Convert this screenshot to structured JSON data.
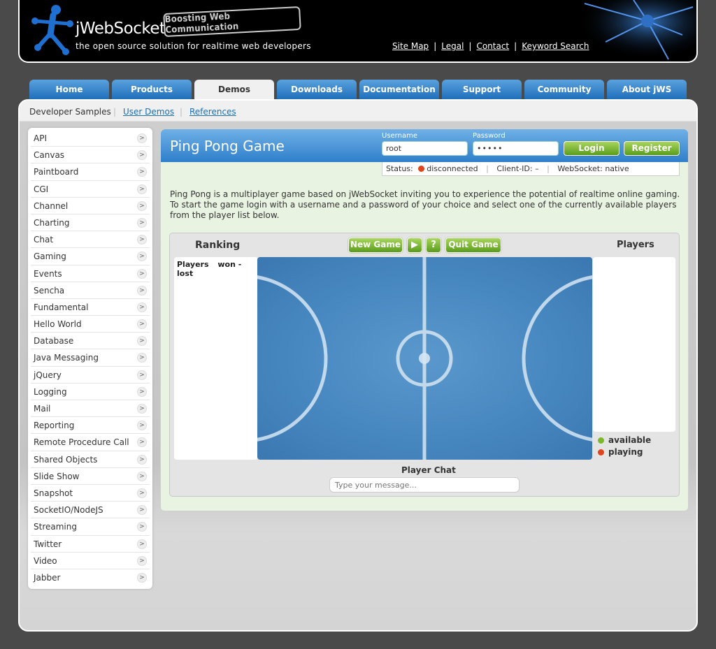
{
  "header": {
    "logo_text": "jWebSocket",
    "slogan": "Boosting Web Communication",
    "tagline": "the open source solution for realtime web developers",
    "links": [
      "Site Map",
      "Legal",
      "Contact",
      "Keyword Search"
    ]
  },
  "tabs": [
    {
      "label": "Home"
    },
    {
      "label": "Products"
    },
    {
      "label": "Demos"
    },
    {
      "label": "Downloads"
    },
    {
      "label": "Documentation"
    },
    {
      "label": "Support"
    },
    {
      "label": "Community"
    },
    {
      "label": "About jWS"
    }
  ],
  "subnav": {
    "current": "Developer Samples",
    "links": [
      "User Demos",
      "References"
    ]
  },
  "sidebar": {
    "items": [
      "API",
      "Canvas",
      "Paintboard",
      "CGI",
      "Channel",
      "Charting",
      "Chat",
      "Gaming",
      "Events",
      "Sencha",
      "Fundamental",
      "Hello World",
      "Database",
      "Java Messaging",
      "jQuery",
      "Logging",
      "Mail",
      "Reporting",
      "Remote Procedure Call",
      "Shared Objects",
      "Slide Show",
      "Snapshot",
      "SocketIO/NodeJS",
      "Streaming",
      "Twitter",
      "Video",
      "Jabber"
    ]
  },
  "page": {
    "title": "Ping Pong Game",
    "description": "Ping Pong is a multiplayer game based on jWebSocket inviting you to experience the potential of realtime online gaming. To start the game login with a username and a password of your choice and select one of the currently available players from the player list below."
  },
  "login": {
    "username_label": "Username",
    "username_value": "root",
    "password_label": "Password",
    "password_value": "•••••",
    "login_label": "Login",
    "register_label": "Register"
  },
  "status": {
    "status_label": "Status:",
    "status_value": "disconnected",
    "client_id": "Client-ID: –",
    "websocket": "WebSocket: native"
  },
  "game": {
    "ranking_title": "Ranking",
    "ranking_col_players": "Players",
    "ranking_col_score": "won - lost",
    "new_game_label": "New Game",
    "play_label": "▶",
    "help_label": "?",
    "quit_game_label": "Quit Game",
    "players_title": "Players",
    "legend_available": "available",
    "legend_playing": "playing",
    "chat_title": "Player Chat",
    "chat_placeholder": "Type your message..."
  },
  "colors": {
    "accent_blue": "#2f7fcb",
    "green_button": "#5a9c1c",
    "status_disconnected": "#e0441a",
    "available": "#7ab82c",
    "playing": "#e0441a"
  }
}
